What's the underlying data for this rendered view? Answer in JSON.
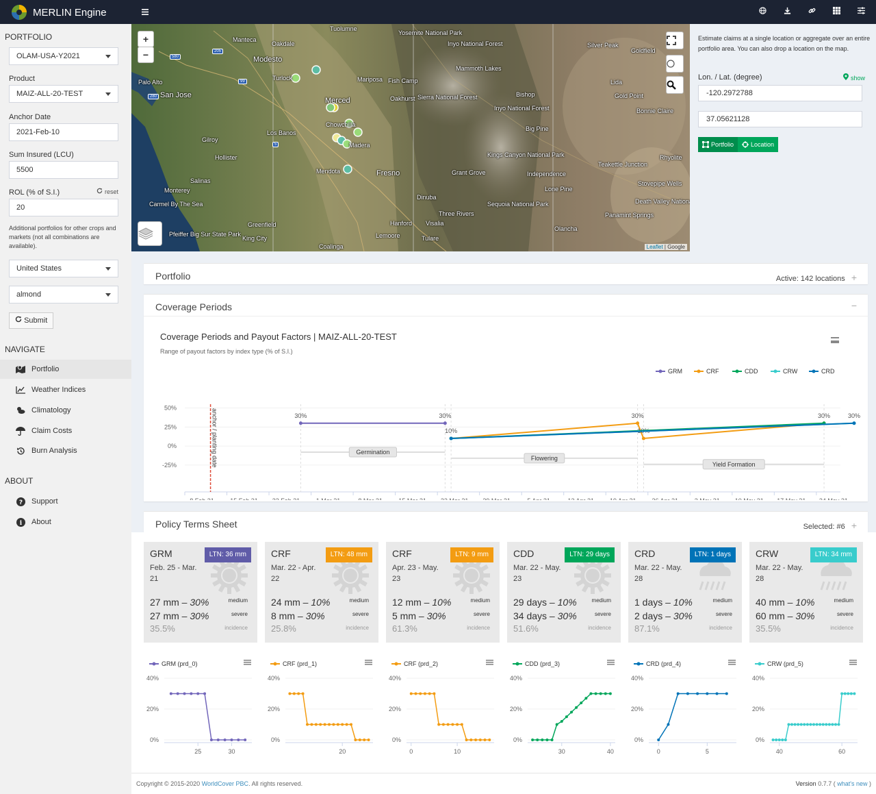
{
  "app": {
    "title": "MERLIN Engine"
  },
  "topbar_icons": [
    "globe-icon",
    "download-icon",
    "link-icon",
    "grid-icon",
    "sliders-icon"
  ],
  "sidebar": {
    "portfolio_heading": "PORTFOLIO",
    "portfolio_value": "OLAM-USA-Y2021",
    "product_label": "Product",
    "product_value": "MAIZ-ALL-20-TEST",
    "anchor_label": "Anchor Date",
    "anchor_value": "2021-Feb-10",
    "sum_label": "Sum Insured (LCU)",
    "sum_value": "5500",
    "rol_label": "ROL (% of S.I.)",
    "rol_reset": "reset",
    "rol_value": "20",
    "note": "Additional portfolios for other crops and markets (not all combinations are available).",
    "country_value": "United States",
    "crop_value": "almond",
    "submit_label": "Submit",
    "navigate_heading": "NAVIGATE",
    "nav": [
      {
        "label": "Portfolio",
        "icon": "map-marker-icon"
      },
      {
        "label": "Weather Indices",
        "icon": "line-chart-icon"
      },
      {
        "label": "Climatology",
        "icon": "cloud-sun-icon"
      },
      {
        "label": "Claim Costs",
        "icon": "umbrella-icon"
      },
      {
        "label": "Burn Analysis",
        "icon": "history-icon"
      }
    ],
    "about_heading": "ABOUT",
    "about": [
      {
        "label": "Support",
        "icon": "question-circle-icon"
      },
      {
        "label": "About",
        "icon": "info-circle-icon"
      }
    ]
  },
  "map": {
    "zoom_in": "+",
    "zoom_out": "−",
    "attribution_leaflet": "Leaflet",
    "attribution_google": "Google",
    "labels": [
      {
        "text": "Tuolumne"
      },
      {
        "text": "Yosemite National Park"
      },
      {
        "text": "Manteca"
      },
      {
        "text": "Oakdale"
      },
      {
        "text": "Inyo National Forest"
      },
      {
        "text": "Silver Peak"
      },
      {
        "text": "Goldfield"
      },
      {
        "text": "Modesto"
      },
      {
        "text": "Mammoth Lakes"
      },
      {
        "text": "Palo Alto"
      },
      {
        "text": "San Jose"
      },
      {
        "text": "Turlock"
      },
      {
        "text": "Mariposa"
      },
      {
        "text": "Fish Camp"
      },
      {
        "text": "Lida"
      },
      {
        "text": "Gold Point"
      },
      {
        "text": "Merced"
      },
      {
        "text": "Oakhurst"
      },
      {
        "text": "Sierra National Forest"
      },
      {
        "text": "Bishop"
      },
      {
        "text": "Inyo National Forest"
      },
      {
        "text": "Bonnie Claire"
      },
      {
        "text": "Chowchilla"
      },
      {
        "text": "Big Pine"
      },
      {
        "text": "Los Banos"
      },
      {
        "text": "Gilroy"
      },
      {
        "text": "Madera"
      },
      {
        "text": "Kings Canyon National Park"
      },
      {
        "text": "Rhyolite"
      },
      {
        "text": "Hollister"
      },
      {
        "text": "Mendota"
      },
      {
        "text": "Fresno"
      },
      {
        "text": "Grant Grove"
      },
      {
        "text": "Independence"
      },
      {
        "text": "Teakettle Junction"
      },
      {
        "text": "Salinas"
      },
      {
        "text": "Lone Pine"
      },
      {
        "text": "Stovepipe Wells"
      },
      {
        "text": "Monterey"
      },
      {
        "text": "Dinuba"
      },
      {
        "text": "Carmel By The Sea"
      },
      {
        "text": "Death Valley National Park"
      },
      {
        "text": "Sequoia National Park"
      },
      {
        "text": "Three Rivers"
      },
      {
        "text": "Panamint Springs"
      },
      {
        "text": "Greenfield"
      },
      {
        "text": "Hanford"
      },
      {
        "text": "Visalia"
      },
      {
        "text": "Olancha"
      },
      {
        "text": "Pfeiffer Big Sur State Park"
      },
      {
        "text": "King City"
      },
      {
        "text": "Lemoore"
      },
      {
        "text": "Tulare"
      },
      {
        "text": "Coalinga"
      }
    ],
    "highway_shields": [
      "580",
      "205",
      "99",
      "280",
      "5"
    ]
  },
  "locate": {
    "intro": "Estimate claims at a single location or aggregate over an entire portfolio area. You can also drop a location on the map.",
    "lonlat_label": "Lon. / Lat. (degree)",
    "show_label": "show",
    "lon_value": "-120.2972788",
    "lat_value": "37.05621128",
    "portfolio_btn": "Portfolio",
    "location_btn": "Location"
  },
  "panels": {
    "portfolio_title": "Portfolio",
    "portfolio_right": "Active: 142 locations",
    "coverage_title": "Coverage Periods",
    "policy_title": "Policy Terms Sheet",
    "policy_right": "Selected: #6"
  },
  "coverage_chart": {
    "title": "Coverage Periods and Payout Factors | MAIZ-ALL-20-TEST",
    "subtitle": "Range of payout factors by index type (% of S.I.)"
  },
  "chart_data": [
    {
      "type": "line",
      "title": "Coverage Periods and Payout Factors | MAIZ-ALL-20-TEST",
      "subtitle": "Range of payout factors by index type (% of S.I.)",
      "x_ticks": [
        "8 Feb 21",
        "15 Feb 21",
        "22 Feb 21",
        "1 Mar 21",
        "8 Mar 21",
        "15 Mar 21",
        "22 Mar 21",
        "29 Mar 21",
        "5 Apr 21",
        "12 Apr 21",
        "19 Apr 21",
        "26 Apr 21",
        "3 May 21",
        "10 May 21",
        "17 May 21",
        "24 May 21"
      ],
      "y_ticks": [
        "50%",
        "25%",
        "0%",
        "-25%"
      ],
      "ylim": [
        -35,
        55
      ],
      "legend": [
        "GRM",
        "CRF",
        "CDD",
        "CRW",
        "CRD"
      ],
      "legend_colors": [
        "#7266ba",
        "#f39c12",
        "#00a65a",
        "#39cccc",
        "#0073b7"
      ],
      "anchor_label": "anchor / planting date",
      "series": [
        {
          "name": "GRM",
          "color": "#7266ba",
          "x": [
            "2021-02-25",
            "2021-03-21"
          ],
          "y": [
            30,
            30
          ],
          "labels": [
            "30%",
            "30%"
          ]
        },
        {
          "name": "CRF",
          "color": "#f39c12",
          "x": [
            "2021-03-22",
            "2021-04-22",
            "2021-04-23",
            "2021-05-23"
          ],
          "y": [
            10,
            30,
            10,
            30
          ],
          "labels": [
            "10%",
            "30%",
            "10%",
            "30%"
          ]
        },
        {
          "name": "CDD",
          "color": "#00a65a",
          "x": [
            "2021-03-22",
            "2021-05-23"
          ],
          "y": [
            10,
            30
          ],
          "labels": [
            "",
            ""
          ]
        },
        {
          "name": "CRW",
          "color": "#39cccc",
          "x": [
            "2021-03-22",
            "2021-05-28"
          ],
          "y": [
            10,
            30
          ],
          "labels": [
            "",
            ""
          ]
        },
        {
          "name": "CRD",
          "color": "#0073b7",
          "x": [
            "2021-03-22",
            "2021-05-28"
          ],
          "y": [
            10,
            30
          ],
          "labels": [
            "",
            "30%"
          ]
        }
      ],
      "phases": [
        {
          "label": "Germination",
          "start": "2021-02-25",
          "end": "2021-03-21",
          "y": -8
        },
        {
          "label": "Flowering",
          "start": "2021-03-22",
          "end": "2021-04-22",
          "y": -16
        },
        {
          "label": "Yield Formation",
          "start": "2021-04-23",
          "end": "2021-05-23",
          "y": -24
        }
      ]
    },
    {
      "type": "line",
      "legend": "GRM (prd_0)",
      "color": "#7266ba",
      "x_ticks": [
        "25",
        "30"
      ],
      "y_ticks": [
        "40%",
        "20%",
        "0%"
      ],
      "x": [
        21,
        22,
        23,
        24,
        25,
        26,
        27,
        28,
        29,
        30,
        31,
        32
      ],
      "y": [
        30,
        30,
        30,
        30,
        30,
        30,
        0,
        0,
        0,
        0,
        0,
        0
      ]
    },
    {
      "type": "line",
      "legend": "CRF (prd_1)",
      "color": "#f39c12",
      "x_ticks": [
        "20"
      ],
      "y_ticks": [
        "40%",
        "20%",
        "0%"
      ],
      "x": [
        8,
        9,
        10,
        11,
        12,
        13,
        14,
        15,
        16,
        17,
        18,
        19,
        20,
        21,
        22,
        23,
        24,
        25,
        26
      ],
      "y": [
        30,
        30,
        30,
        30,
        10,
        10,
        10,
        10,
        10,
        10,
        10,
        10,
        10,
        10,
        10,
        0,
        0,
        0,
        0
      ]
    },
    {
      "type": "line",
      "legend": "CRF (prd_2)",
      "color": "#f39c12",
      "x_ticks": [
        "0",
        "10"
      ],
      "y_ticks": [
        "40%",
        "20%",
        "0%"
      ],
      "x": [
        0,
        1,
        2,
        3,
        4,
        5,
        6,
        7,
        8,
        9,
        10,
        11,
        12,
        13,
        14,
        15,
        16,
        17
      ],
      "y": [
        30,
        30,
        30,
        30,
        30,
        30,
        10,
        10,
        10,
        10,
        10,
        10,
        0,
        0,
        0,
        0,
        0,
        0
      ]
    },
    {
      "type": "line",
      "legend": "CDD (prd_3)",
      "color": "#00a65a",
      "x_ticks": [
        "30",
        "40"
      ],
      "y_ticks": [
        "40%",
        "20%",
        "0%"
      ],
      "x": [
        24,
        25,
        26,
        27,
        28,
        29,
        30,
        31,
        32,
        33,
        34,
        35,
        36,
        37,
        38,
        39,
        40
      ],
      "y": [
        0,
        0,
        0,
        0,
        0,
        10,
        12,
        15,
        18,
        21,
        24,
        27,
        30,
        30,
        30,
        30,
        30
      ]
    },
    {
      "type": "line",
      "legend": "CRD (prd_4)",
      "color": "#0073b7",
      "x_ticks": [
        "0",
        "5"
      ],
      "y_ticks": [
        "40%",
        "20%",
        "0%"
      ],
      "x": [
        0,
        1,
        2,
        3,
        4,
        5,
        6,
        7
      ],
      "y": [
        0,
        10,
        30,
        30,
        30,
        30,
        30,
        30
      ]
    },
    {
      "type": "line",
      "legend": "CRW (prd_5)",
      "color": "#39cccc",
      "x_ticks": [
        "40",
        "60"
      ],
      "y_ticks": [
        "40%",
        "20%",
        "0%"
      ],
      "x": [
        38,
        39,
        40,
        41,
        42,
        43,
        44,
        45,
        46,
        47,
        48,
        49,
        50,
        51,
        52,
        53,
        54,
        55,
        56,
        57,
        58,
        59,
        60,
        61,
        62,
        63,
        64
      ],
      "y": [
        0,
        0,
        0,
        0,
        0,
        10,
        10,
        10,
        10,
        10,
        10,
        10,
        10,
        10,
        10,
        10,
        10,
        10,
        10,
        10,
        10,
        10,
        30,
        30,
        30,
        30,
        30
      ]
    }
  ],
  "cards": [
    {
      "type": "GRM",
      "ltn": "LTN: 36 mm",
      "color": "#605ca8",
      "dates": "Feb. 25 - Mar. 21",
      "icon": "sun-icon",
      "row1": "27 mm",
      "row1pct": "30%",
      "row2": "27 mm",
      "row2pct": "30%",
      "incidence": "35.5%"
    },
    {
      "type": "CRF",
      "ltn": "LTN: 48 mm",
      "color": "#f39c12",
      "dates": "Mar. 22 - Apr. 22",
      "icon": "sun-icon",
      "row1": "24 mm",
      "row1pct": "10%",
      "row2": "8 mm",
      "row2pct": "30%",
      "incidence": "25.8%"
    },
    {
      "type": "CRF",
      "ltn": "LTN: 9 mm",
      "color": "#f39c12",
      "dates": "Apr. 23 - May. 23",
      "icon": "sun-icon",
      "row1": "12 mm",
      "row1pct": "10%",
      "row2": "5 mm",
      "row2pct": "30%",
      "incidence": "61.3%"
    },
    {
      "type": "CDD",
      "ltn": "LTN: 29 days",
      "color": "#00a65a",
      "dates": "Mar. 22 - May. 23",
      "icon": "sun-icon",
      "row1": "29 days",
      "row1pct": "10%",
      "row2": "34 days",
      "row2pct": "30%",
      "incidence": "51.6%"
    },
    {
      "type": "CRD",
      "ltn": "LTN: 1 days",
      "color": "#0073b7",
      "dates": "Mar. 22 - May. 28",
      "icon": "rain-icon",
      "row1": "1 days",
      "row1pct": "10%",
      "row2": "2 days",
      "row2pct": "30%",
      "incidence": "87.1%"
    },
    {
      "type": "CRW",
      "ltn": "LTN: 34 mm",
      "color": "#39cccc",
      "dates": "Mar. 22 - May. 28",
      "icon": "rain-icon",
      "row1": "40 mm",
      "row1pct": "10%",
      "row2": "60 mm",
      "row2pct": "30%",
      "incidence": "35.5%"
    }
  ],
  "card_tags": {
    "medium": "medium",
    "severe": "severe",
    "incidence": "incidence"
  },
  "footer": {
    "copyright_pre": "Copyright © 2015-2020 ",
    "company": "WorldCover PBC",
    "copyright_post": ". All rights reserved.",
    "version_label": "Version",
    "version": "0.7.7",
    "whats_new": "what's new"
  }
}
